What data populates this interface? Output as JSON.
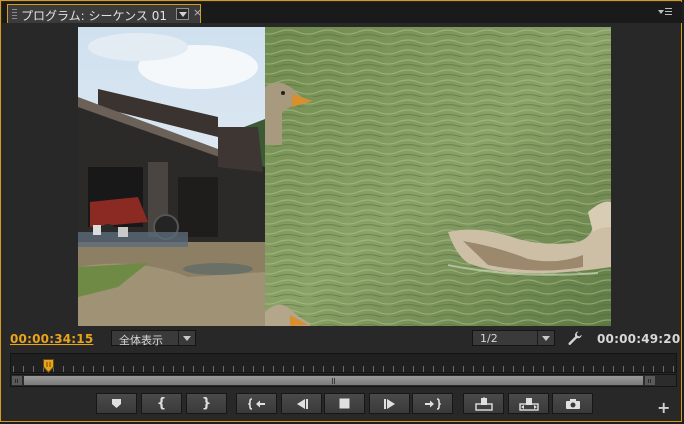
{
  "tab": {
    "title": "プログラム: シーケンス 01",
    "close": "×"
  },
  "timecodes": {
    "current": "00:00:34:15",
    "duration": "00:00:49:20"
  },
  "zoom_select": {
    "value": "全体表示"
  },
  "resolution_select": {
    "value": "1/2"
  },
  "playback": {
    "playhead_fraction": 0.055
  },
  "transport": [
    {
      "name": "add-marker",
      "icon": "marker-icon"
    },
    {
      "name": "mark-in",
      "icon": "in-point-icon",
      "glyph": "{"
    },
    {
      "name": "mark-out",
      "icon": "out-point-icon",
      "glyph": "}"
    },
    {
      "name": "go-to-in",
      "icon": "go-to-in-icon"
    },
    {
      "name": "step-back",
      "icon": "step-back-icon"
    },
    {
      "name": "stop",
      "icon": "stop-icon"
    },
    {
      "name": "step-forward",
      "icon": "step-forward-icon"
    },
    {
      "name": "go-to-out",
      "icon": "go-to-out-icon"
    },
    {
      "name": "lift",
      "icon": "lift-icon"
    },
    {
      "name": "extract",
      "icon": "extract-icon"
    },
    {
      "name": "export-frame",
      "icon": "camera-icon"
    }
  ],
  "colors": {
    "accent": "#d79a1d",
    "timecode_current": "#e8a41c"
  }
}
